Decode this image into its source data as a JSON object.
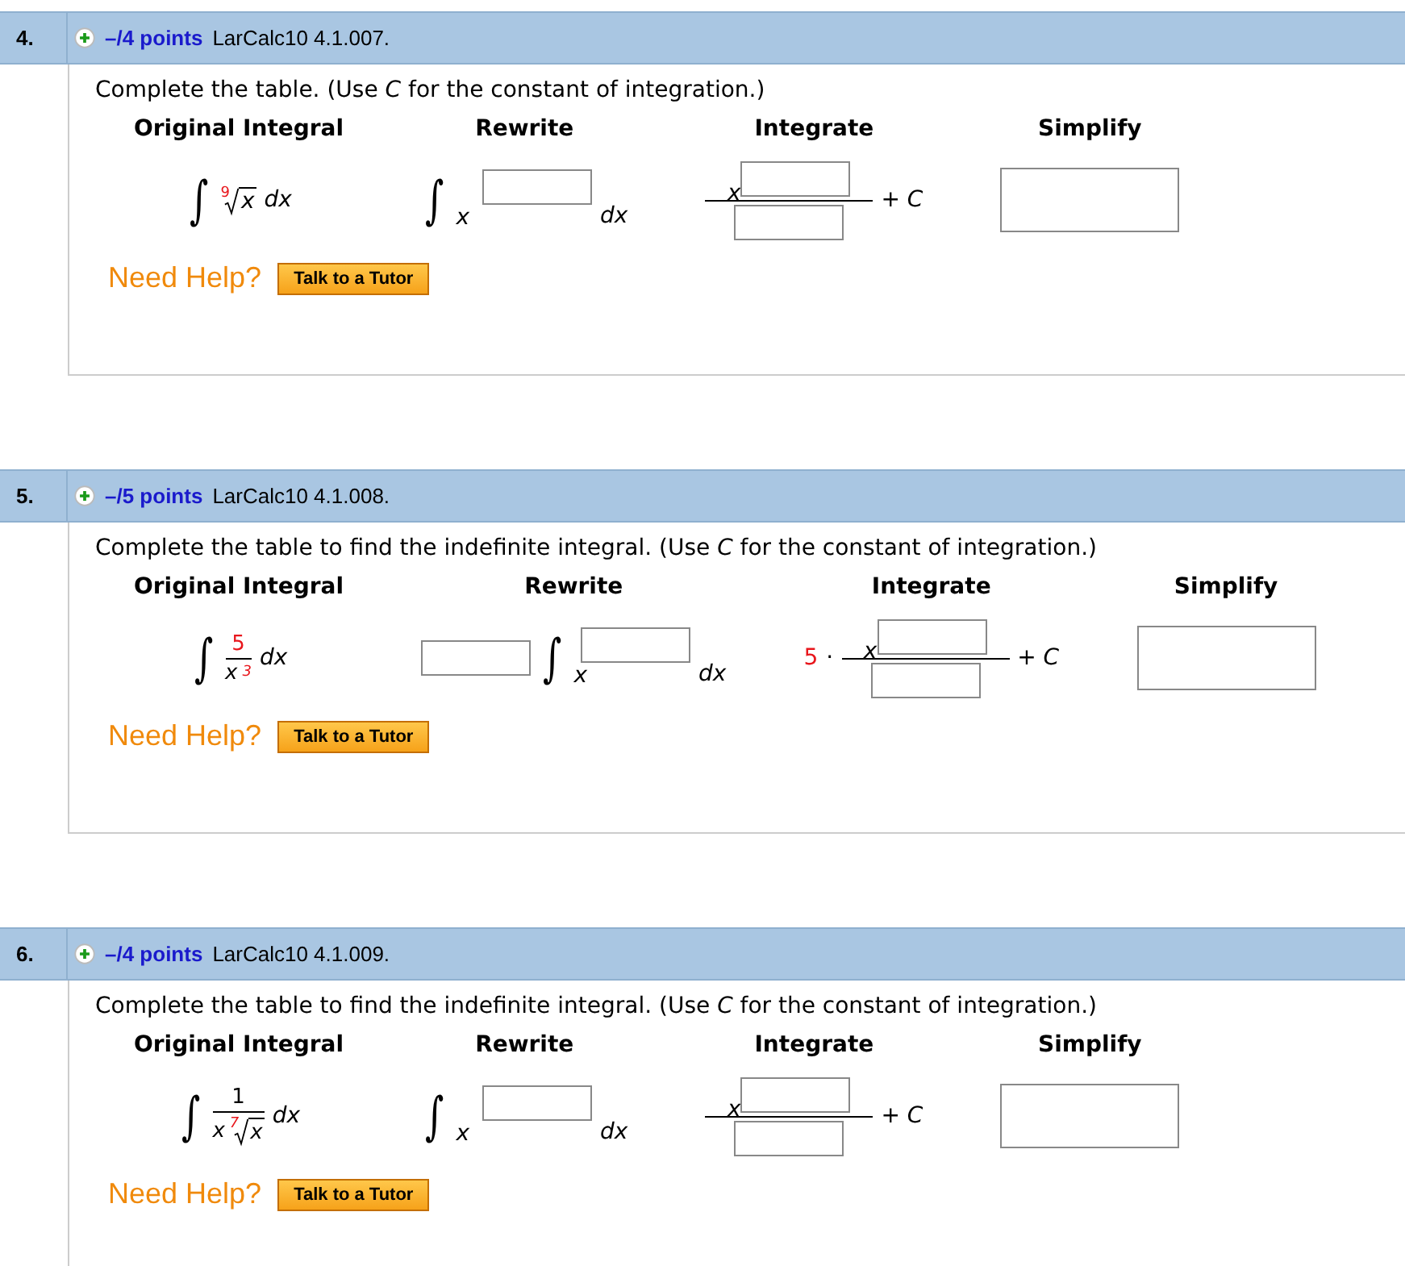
{
  "problems": [
    {
      "number": "4.",
      "points": "–/4 points",
      "code": "LarCalc10 4.1.007.",
      "instruction": "Complete the table. (Use *C* for the constant of integration.)",
      "headers": [
        "Original Integral",
        "Rewrite",
        "Integrate",
        "Simplify"
      ],
      "original": {
        "kind": "root",
        "sign": "∫",
        "index": "9",
        "radicand": "x",
        "differential": "dx"
      },
      "rewrite": {
        "kind": "power",
        "sign": "∫",
        "base": "x",
        "differential": "dx"
      },
      "integrate": {
        "base": "x",
        "constant": "+ C"
      },
      "help": "Need Help?",
      "tutor": "Talk to a Tutor"
    },
    {
      "number": "5.",
      "points": "–/5 points",
      "code": "LarCalc10 4.1.008.",
      "instruction": "Complete the table to find the indefinite integral. (Use *C* for the constant of integration.)",
      "headers": [
        "Original Integral",
        "Rewrite",
        "Integrate",
        "Simplify"
      ],
      "original": {
        "kind": "fraction",
        "sign": "∫",
        "numerator": "5",
        "denominator": "x",
        "power": "3",
        "differential": "dx"
      },
      "rewrite": {
        "kind": "coefficient-power",
        "sign": "∫",
        "base": "x",
        "differential": "dx"
      },
      "integrate": {
        "coefficient": "5",
        "dot": "·",
        "base": "x",
        "constant": "+ C"
      },
      "help": "Need Help?",
      "tutor": "Talk to a Tutor"
    },
    {
      "number": "6.",
      "points": "–/4 points",
      "code": "LarCalc10 4.1.009.",
      "instruction": "Complete the table to find the indefinite integral. (Use *C* for the constant of integration.)",
      "headers": [
        "Original Integral",
        "Rewrite",
        "Integrate",
        "Simplify"
      ],
      "original": {
        "kind": "fraction-root",
        "sign": "∫",
        "numerator": "1",
        "factor": "x",
        "index": "7",
        "radicand": "x",
        "differential": "dx"
      },
      "rewrite": {
        "kind": "power",
        "sign": "∫",
        "base": "x",
        "differential": "dx"
      },
      "integrate": {
        "base": "x",
        "constant": "+ C"
      },
      "help": "Need Help?",
      "tutor": "Talk to a Tutor"
    }
  ]
}
